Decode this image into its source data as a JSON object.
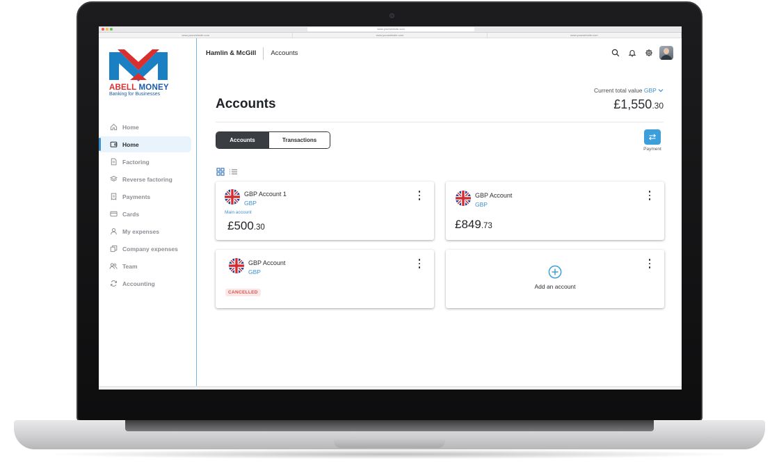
{
  "browser": {
    "url": "www.yourwebsite.com",
    "tabs": [
      "www.yourwebsite.com",
      "www.yourwebsite.com",
      "www.yourwebsite.com"
    ]
  },
  "brand": {
    "name_part1": "ABELL",
    "name_part2": "MONEY",
    "tagline": "Banking for Businesses",
    "colors": {
      "blue": "#1b5ba7",
      "red": "#d92f2f"
    }
  },
  "sidebar": {
    "items": [
      {
        "label": "Home",
        "icon": "home-icon",
        "active": false
      },
      {
        "label": "Home",
        "icon": "wallet-icon",
        "active": true
      },
      {
        "label": "Factoring",
        "icon": "document-icon",
        "active": false
      },
      {
        "label": "Reverse factoring",
        "icon": "layers-icon",
        "active": false
      },
      {
        "label": "Payments",
        "icon": "receipt-icon",
        "active": false
      },
      {
        "label": "Cards",
        "icon": "card-icon",
        "active": false
      },
      {
        "label": "My expenses",
        "icon": "user-icon",
        "active": false
      },
      {
        "label": "Company expenses",
        "icon": "copy-icon",
        "active": false
      },
      {
        "label": "Team",
        "icon": "team-icon",
        "active": false
      },
      {
        "label": "Accounting",
        "icon": "sync-icon",
        "active": false
      }
    ]
  },
  "header": {
    "company": "Hamlin & McGill",
    "breadcrumb": "Accounts",
    "icons": [
      "search-icon",
      "bell-icon",
      "gear-icon",
      "avatar"
    ]
  },
  "page": {
    "title": "Accounts",
    "total_label": "Current total value",
    "total_currency": "GBP",
    "total_main": "£1,550",
    "total_decimals": ".30"
  },
  "tabs": {
    "accounts": "Accounts",
    "transactions": "Transactions",
    "active": "accounts"
  },
  "payment": {
    "label": "Payment"
  },
  "accounts": [
    {
      "name": "GBP Account 1",
      "currency": "GBP",
      "note": "Main account",
      "balance_main": "£500",
      "balance_decimals": ".30"
    },
    {
      "name": "GBP Account",
      "currency": "GBP",
      "balance_main": "£849",
      "balance_decimals": ".73"
    },
    {
      "name": "GBP Account",
      "currency": "GBP",
      "status": "CANCELLED"
    }
  ],
  "add_account": {
    "label": "Add an account"
  },
  "accent": "#3d8fd0"
}
